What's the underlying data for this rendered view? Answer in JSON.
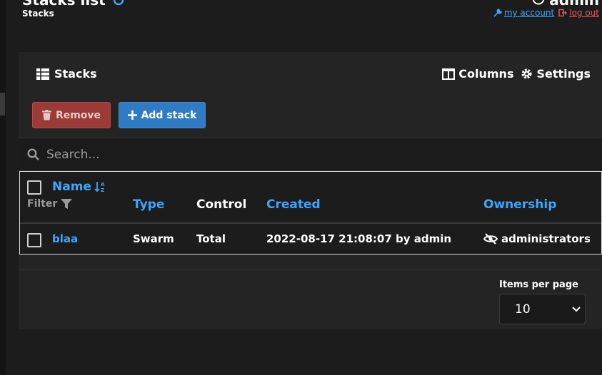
{
  "header": {
    "title": "Stacks list",
    "breadcrumb": "Stacks",
    "user": "admin",
    "my_account": "my account",
    "log_out": "log out"
  },
  "panel": {
    "title": "Stacks",
    "columns_label": "Columns",
    "settings_label": "Settings",
    "remove_label": "Remove",
    "add_label": "Add stack",
    "search_placeholder": "Search..."
  },
  "table": {
    "headers": {
      "name": "Name",
      "filter": "Filter",
      "type": "Type",
      "control": "Control",
      "created": "Created",
      "ownership": "Ownership"
    },
    "rows": [
      {
        "name": "blaa",
        "type": "Swarm",
        "control": "Total",
        "created": "2022-08-17 21:08:07 by admin",
        "ownership": "administrators"
      }
    ]
  },
  "pagination": {
    "label": "Items per page",
    "value": "10"
  },
  "colors": {
    "accent": "#3da6ff",
    "danger": "#9b3b37",
    "primary": "#2f7cc4",
    "logout": "#e8525a"
  }
}
